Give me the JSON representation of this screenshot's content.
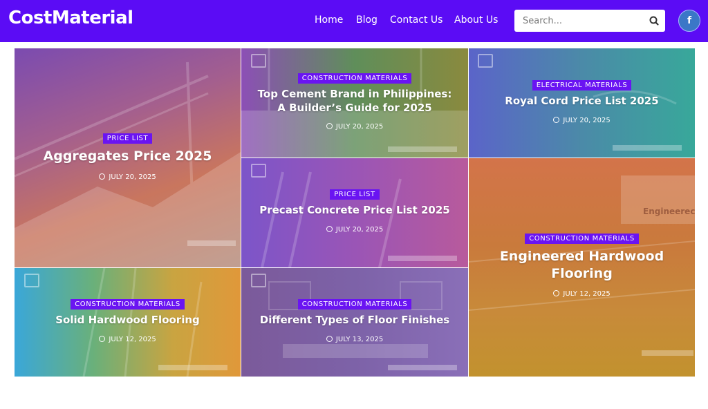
{
  "brand": {
    "name": "CostMaterial"
  },
  "nav": [
    {
      "label": "Home"
    },
    {
      "label": "Blog"
    },
    {
      "label": "Contact Us"
    },
    {
      "label": "About Us"
    }
  ],
  "search": {
    "placeholder": "Search...",
    "icon": "search-icon"
  },
  "social": {
    "facebook_label": "f"
  },
  "colors": {
    "header": "#5b0cf5",
    "badge": "#6a14f2"
  },
  "posts": [
    {
      "category": "PRICE LIST",
      "title": "Aggregates Price 2025",
      "date": "JULY 20, 2025"
    },
    {
      "category": "CONSTRUCTION MATERIALS",
      "title": "Top Cement Brand in Philippines: A Builder’s Guide for 2025",
      "date": "JULY 20, 2025"
    },
    {
      "category": "ELECTRICAL MATERIALS",
      "title": "Royal Cord Price List 2025",
      "date": "JULY 20, 2025"
    },
    {
      "category": "PRICE LIST",
      "title": "Precast Concrete Price List 2025",
      "date": "JULY 20, 2025"
    },
    {
      "category": "CONSTRUCTION MATERIALS",
      "title": "Engineered Hardwood Flooring",
      "date": "JULY 12, 2025"
    },
    {
      "category": "CONSTRUCTION MATERIALS",
      "title": "Solid Hardwood Flooring",
      "date": "JULY 12, 2025"
    },
    {
      "category": "CONSTRUCTION MATERIALS",
      "title": "Different Types of Floor Finishes",
      "date": "JULY 13, 2025"
    }
  ]
}
